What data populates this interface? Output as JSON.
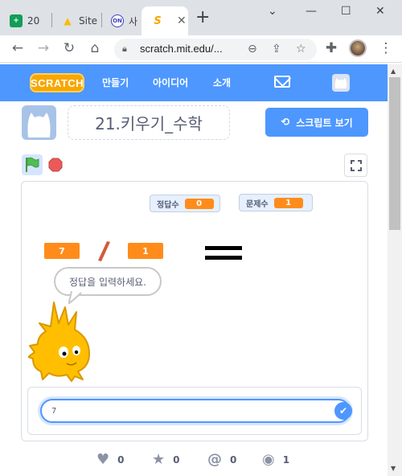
{
  "browser": {
    "tabs": [
      {
        "title": "20",
        "favicon_color": "#0f9d58",
        "favicon_glyph": "+"
      },
      {
        "title": "Site",
        "favicon_color": "#fbbc04",
        "favicon_glyph": "▲"
      },
      {
        "title": "사",
        "favicon_color": "#4040c0",
        "favicon_glyph": "ON"
      },
      {
        "title": "",
        "favicon_color": "#ffffff",
        "favicon_glyph": "S",
        "active": true
      }
    ],
    "url": "scratch.mit.edu/...",
    "icons": [
      "back-icon",
      "forward-icon",
      "reload-icon",
      "home-icon",
      "lock-icon",
      "zoom-icon",
      "share-icon",
      "star-icon",
      "extensions-icon",
      "profile-avatar"
    ]
  },
  "scratch_nav": {
    "logo": "SCRATCH",
    "links": [
      "만들기",
      "아이디어",
      "소개"
    ]
  },
  "project": {
    "title": "21.키우기_수학",
    "see_inside": "스크립트 보기"
  },
  "stage": {
    "monitors": [
      {
        "label": "정답수",
        "value": "0"
      },
      {
        "label": "문제수",
        "value": "1"
      }
    ],
    "left_operand": "7",
    "right_operand": "1",
    "speech": "정답을 입력하세요.",
    "answer_value": "7"
  },
  "stats": [
    {
      "icon": "heart-icon",
      "value": "0"
    },
    {
      "icon": "star-icon",
      "value": "0"
    },
    {
      "icon": "remix-icon",
      "value": "0"
    },
    {
      "icon": "eye-icon",
      "value": "1"
    }
  ],
  "colors": {
    "scratch_blue": "#4d97ff",
    "orange": "#ff8c1a",
    "text": "#575e75"
  }
}
